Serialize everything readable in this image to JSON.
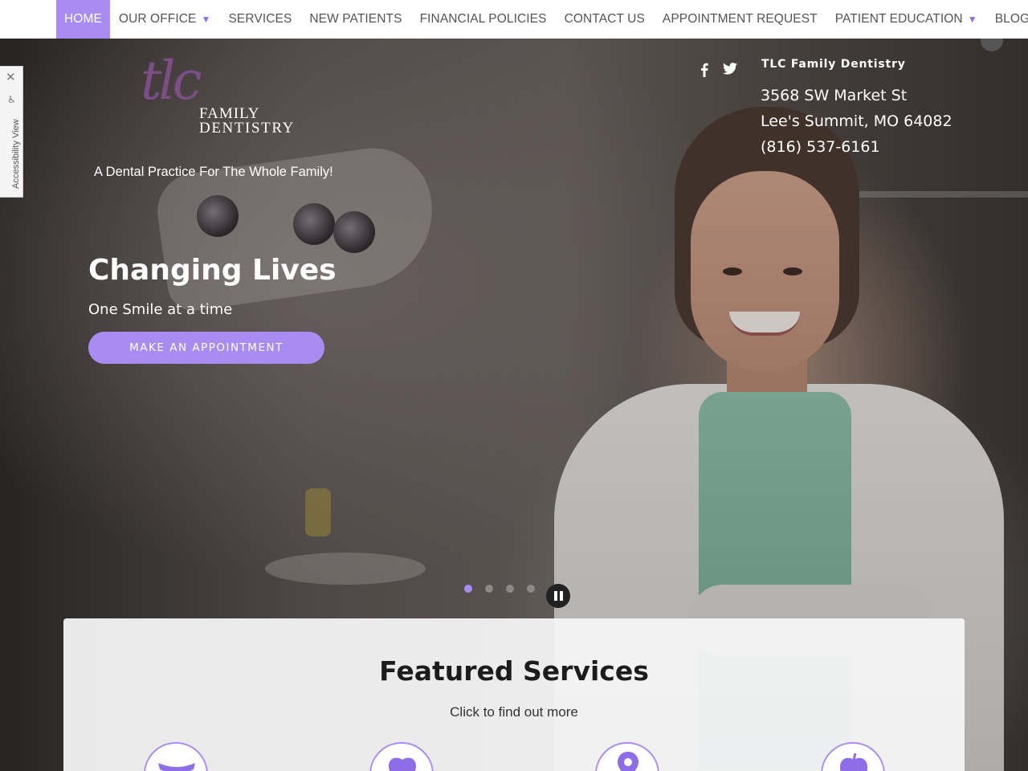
{
  "nav": {
    "items": [
      {
        "label": "HOME",
        "active": true,
        "dropdown": false
      },
      {
        "label": "OUR OFFICE",
        "active": false,
        "dropdown": true
      },
      {
        "label": "SERVICES",
        "active": false,
        "dropdown": false
      },
      {
        "label": "NEW PATIENTS",
        "active": false,
        "dropdown": false
      },
      {
        "label": "FINANCIAL POLICIES",
        "active": false,
        "dropdown": false
      },
      {
        "label": "CONTACT US",
        "active": false,
        "dropdown": false
      },
      {
        "label": "APPOINTMENT REQUEST",
        "active": false,
        "dropdown": false
      },
      {
        "label": "PATIENT EDUCATION",
        "active": false,
        "dropdown": true
      },
      {
        "label": "BLOG",
        "active": false,
        "dropdown": false
      }
    ],
    "caret": "▼"
  },
  "brand": {
    "logo_mark": "tlc",
    "logo_line1": "FAMILY",
    "logo_line2": "DENTISTRY",
    "tagline": "A Dental Practice For The Whole Family!"
  },
  "hero": {
    "headline": "Changing Lives",
    "subhead": "One Smile at a time",
    "cta_label": "MAKE AN APPOINTMENT"
  },
  "contact": {
    "practice_name": "TLC Family Dentistry",
    "street": "3568 SW Market St",
    "city_line": "Lee's Summit, MO 64082",
    "phone": "(816) 537-6161",
    "social": [
      {
        "name": "facebook-icon",
        "glyph": "f"
      },
      {
        "name": "twitter-icon",
        "glyph": "t"
      }
    ]
  },
  "slider": {
    "dot_count": 4,
    "active_index": 0
  },
  "featured": {
    "title": "Featured Services",
    "subtitle": "Click to find out more",
    "icons": [
      "smile-icon",
      "tooth-icon",
      "location-pin-icon",
      "apple-icon"
    ]
  },
  "accessibility": {
    "label": "Accessibility View",
    "close_glyph": "✕",
    "person_glyph": "♿"
  },
  "colors": {
    "accent": "#a98cf2",
    "accent_dark": "#8d6ee8",
    "logo_purple": "#7d4d86"
  }
}
